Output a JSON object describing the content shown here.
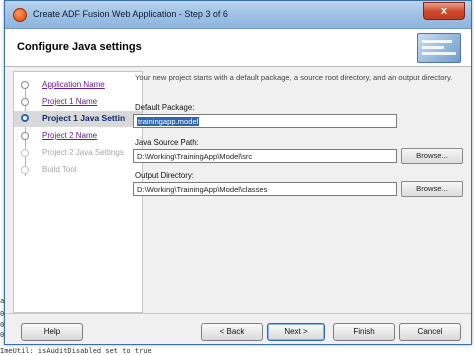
{
  "window": {
    "title": "Create ADF Fusion Web Application - Step 3 of 6",
    "close_label": "x"
  },
  "header": {
    "title": "Configure Java settings"
  },
  "steps": [
    {
      "label": "Application Name",
      "state": "visited"
    },
    {
      "label": "Project 1 Name",
      "state": "visited"
    },
    {
      "label": "Project 1 Java Settin",
      "state": "current"
    },
    {
      "label": "Project 2 Name",
      "state": "visited"
    },
    {
      "label": "Project 2 Java Settings",
      "state": "disabled"
    },
    {
      "label": "Build Tool",
      "state": "disabled"
    }
  ],
  "main": {
    "description": "Your new project starts with a default package, a source root directory, and an output directory.",
    "default_package_label": "Default Package:",
    "default_package_value": "trainingapp.model",
    "java_source_label": "Java Source Path:",
    "java_source_value": "D:\\Working\\TrainingApp\\Model\\src",
    "output_dir_label": "Output Directory:",
    "output_dir_value": "D:\\Working\\TrainingApp\\Model\\classes",
    "browse_label": "Browse..."
  },
  "buttons": {
    "help": "Help",
    "back": "< Back",
    "next": "Next >",
    "finish": "Finish",
    "cancel": "Cancel"
  },
  "background_console": {
    "lines": [
      "ag",
      "02",
      "02",
      "02",
      "ImeUtil: isAuditDisabled set to true"
    ]
  }
}
